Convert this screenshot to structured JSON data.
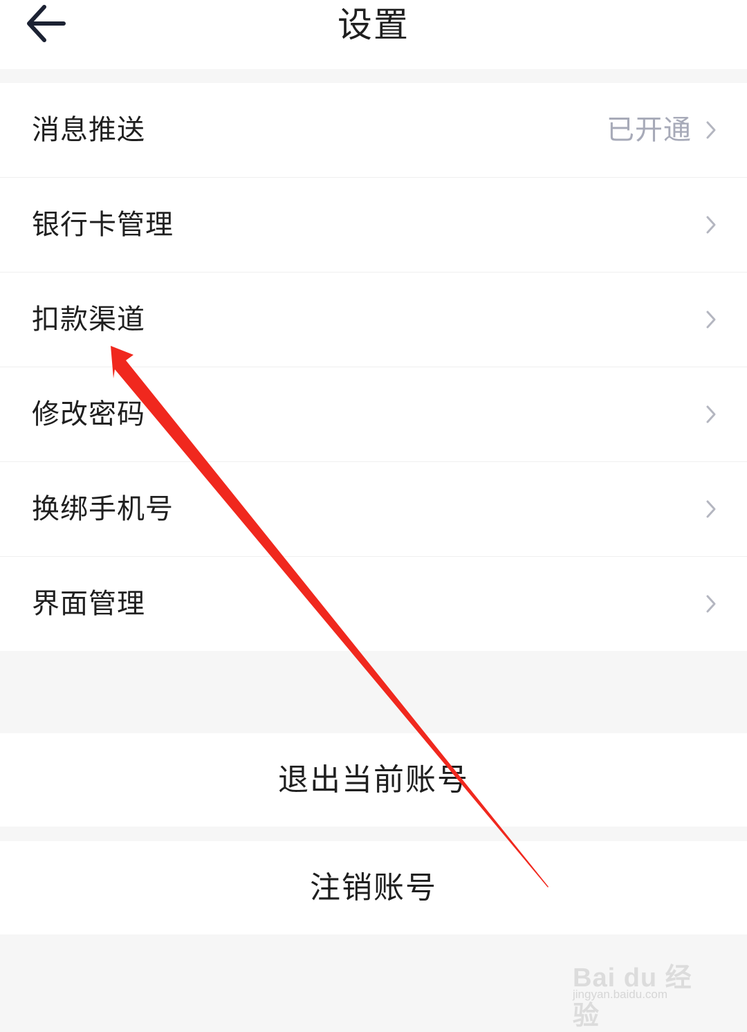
{
  "header": {
    "title": "设置"
  },
  "menu": {
    "items": [
      {
        "label": "消息推送",
        "value": "已开通"
      },
      {
        "label": "银行卡管理",
        "value": ""
      },
      {
        "label": "扣款渠道",
        "value": ""
      },
      {
        "label": "修改密码",
        "value": ""
      },
      {
        "label": "换绑手机号",
        "value": ""
      },
      {
        "label": "界面管理",
        "value": ""
      }
    ]
  },
  "actions": {
    "logout_label": "退出当前账号",
    "cancel_account_label": "注销账号"
  },
  "watermark": {
    "brand": "Bai du 经验",
    "site": "jingyan.baidu.com"
  },
  "icons": {
    "back": "arrow-left-icon",
    "chevron": "chevron-right-icon"
  },
  "colors": {
    "background": "#f6f6f6",
    "surface": "#ffffff",
    "text_primary": "#1f1f1f",
    "text_secondary": "#a7aab8",
    "annotation_arrow": "#f0281e"
  }
}
